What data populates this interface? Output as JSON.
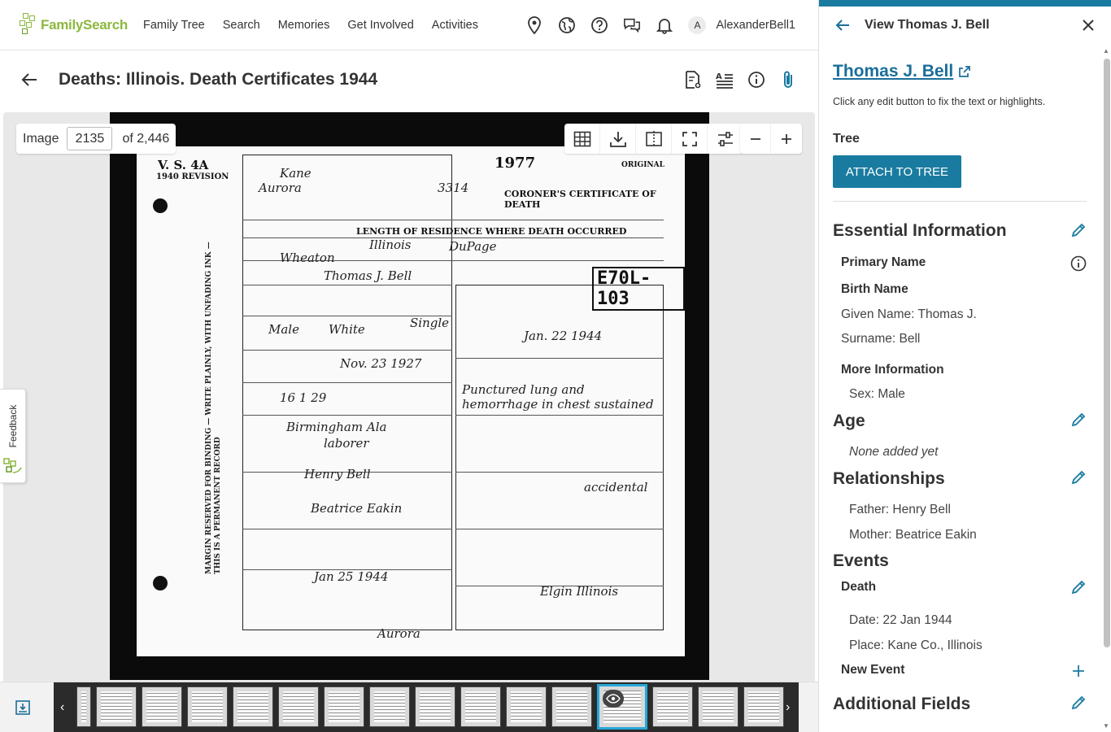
{
  "nav": {
    "logo_text": "FamilySearch",
    "links": [
      "Family Tree",
      "Search",
      "Memories",
      "Get Involved",
      "Activities"
    ],
    "avatar_initial": "A",
    "username": "AlexanderBell1"
  },
  "title_bar": {
    "title": "Deaths: Illinois. Death Certificates 1944"
  },
  "viewer": {
    "image_label": "Image",
    "image_number": "2135",
    "image_total": "of 2,446"
  },
  "document": {
    "form_code": "V. S. 4A",
    "revision": "1940 REVISION",
    "year_stamp": "1977",
    "original_label": "ORIGINAL",
    "certificate_title": "CORONER'S CERTIFICATE OF DEATH",
    "residence_header": "LENGTH OF RESIDENCE WHERE DEATH OCCURRED",
    "file_number": "E70L-103",
    "margin_text": "MARGIN RESERVED FOR BINDING — WRITE PLAINLY, WITH UNFADING INK — THIS IS A PERMANENT RECORD",
    "handwriting": {
      "county": "Kane",
      "city": "Aurora",
      "reg_no": "3314",
      "residence_state": "Illinois",
      "residence_county": "DuPage",
      "residence_city": "Wheaton",
      "full_name": "Thomas J. Bell",
      "sex": "Male",
      "color": "White",
      "marital": "Single",
      "birth_date": "Nov. 23 1927",
      "age": "16  1  29",
      "birthplace": "Birmingham Ala",
      "occupation": "laborer",
      "father": "Henry Bell",
      "mother": "Beatrice Eakin",
      "death_date": "Jan. 22 1944",
      "cause": "Punctured lung and hemorrhage in chest sustained",
      "manner": "accidental",
      "burial_date": "Jan 25 1944",
      "undertaker_city": "Aurora",
      "signed_place": "Elgin Illinois"
    }
  },
  "feedback_label": "Feedback",
  "panel": {
    "header_title": "View Thomas J. Bell",
    "person_name": "Thomas J. Bell",
    "hint": "Click any edit button to fix the text or highlights.",
    "tree_label": "Tree",
    "attach_button": "ATTACH TO TREE",
    "essential": {
      "heading": "Essential Information",
      "primary_name": "Primary Name",
      "birth_name": "Birth Name",
      "given_name": "Given Name: Thomas J.",
      "surname": "Surname: Bell",
      "more_info": "More Information",
      "sex": "Sex: Male"
    },
    "age": {
      "heading": "Age",
      "value": "None added yet"
    },
    "relationships": {
      "heading": "Relationships",
      "father": "Father: Henry Bell",
      "mother": "Mother: Beatrice Eakin"
    },
    "events": {
      "heading": "Events",
      "death_label": "Death",
      "date": "Date: 22 Jan 1944",
      "place": "Place: Kane Co., Illinois",
      "new_event": "New Event"
    },
    "additional": {
      "heading": "Additional Fields"
    }
  },
  "icons": {
    "pin": "map-pin-icon",
    "globe": "globe-icon",
    "help": "help-icon",
    "chat": "chat-icon",
    "bell": "bell-icon"
  },
  "colors": {
    "brand_green": "#8cb83f",
    "accent_blue": "#1a7ba0",
    "link_blue": "#1a6e9a",
    "active_thumb": "#27a7d8"
  }
}
